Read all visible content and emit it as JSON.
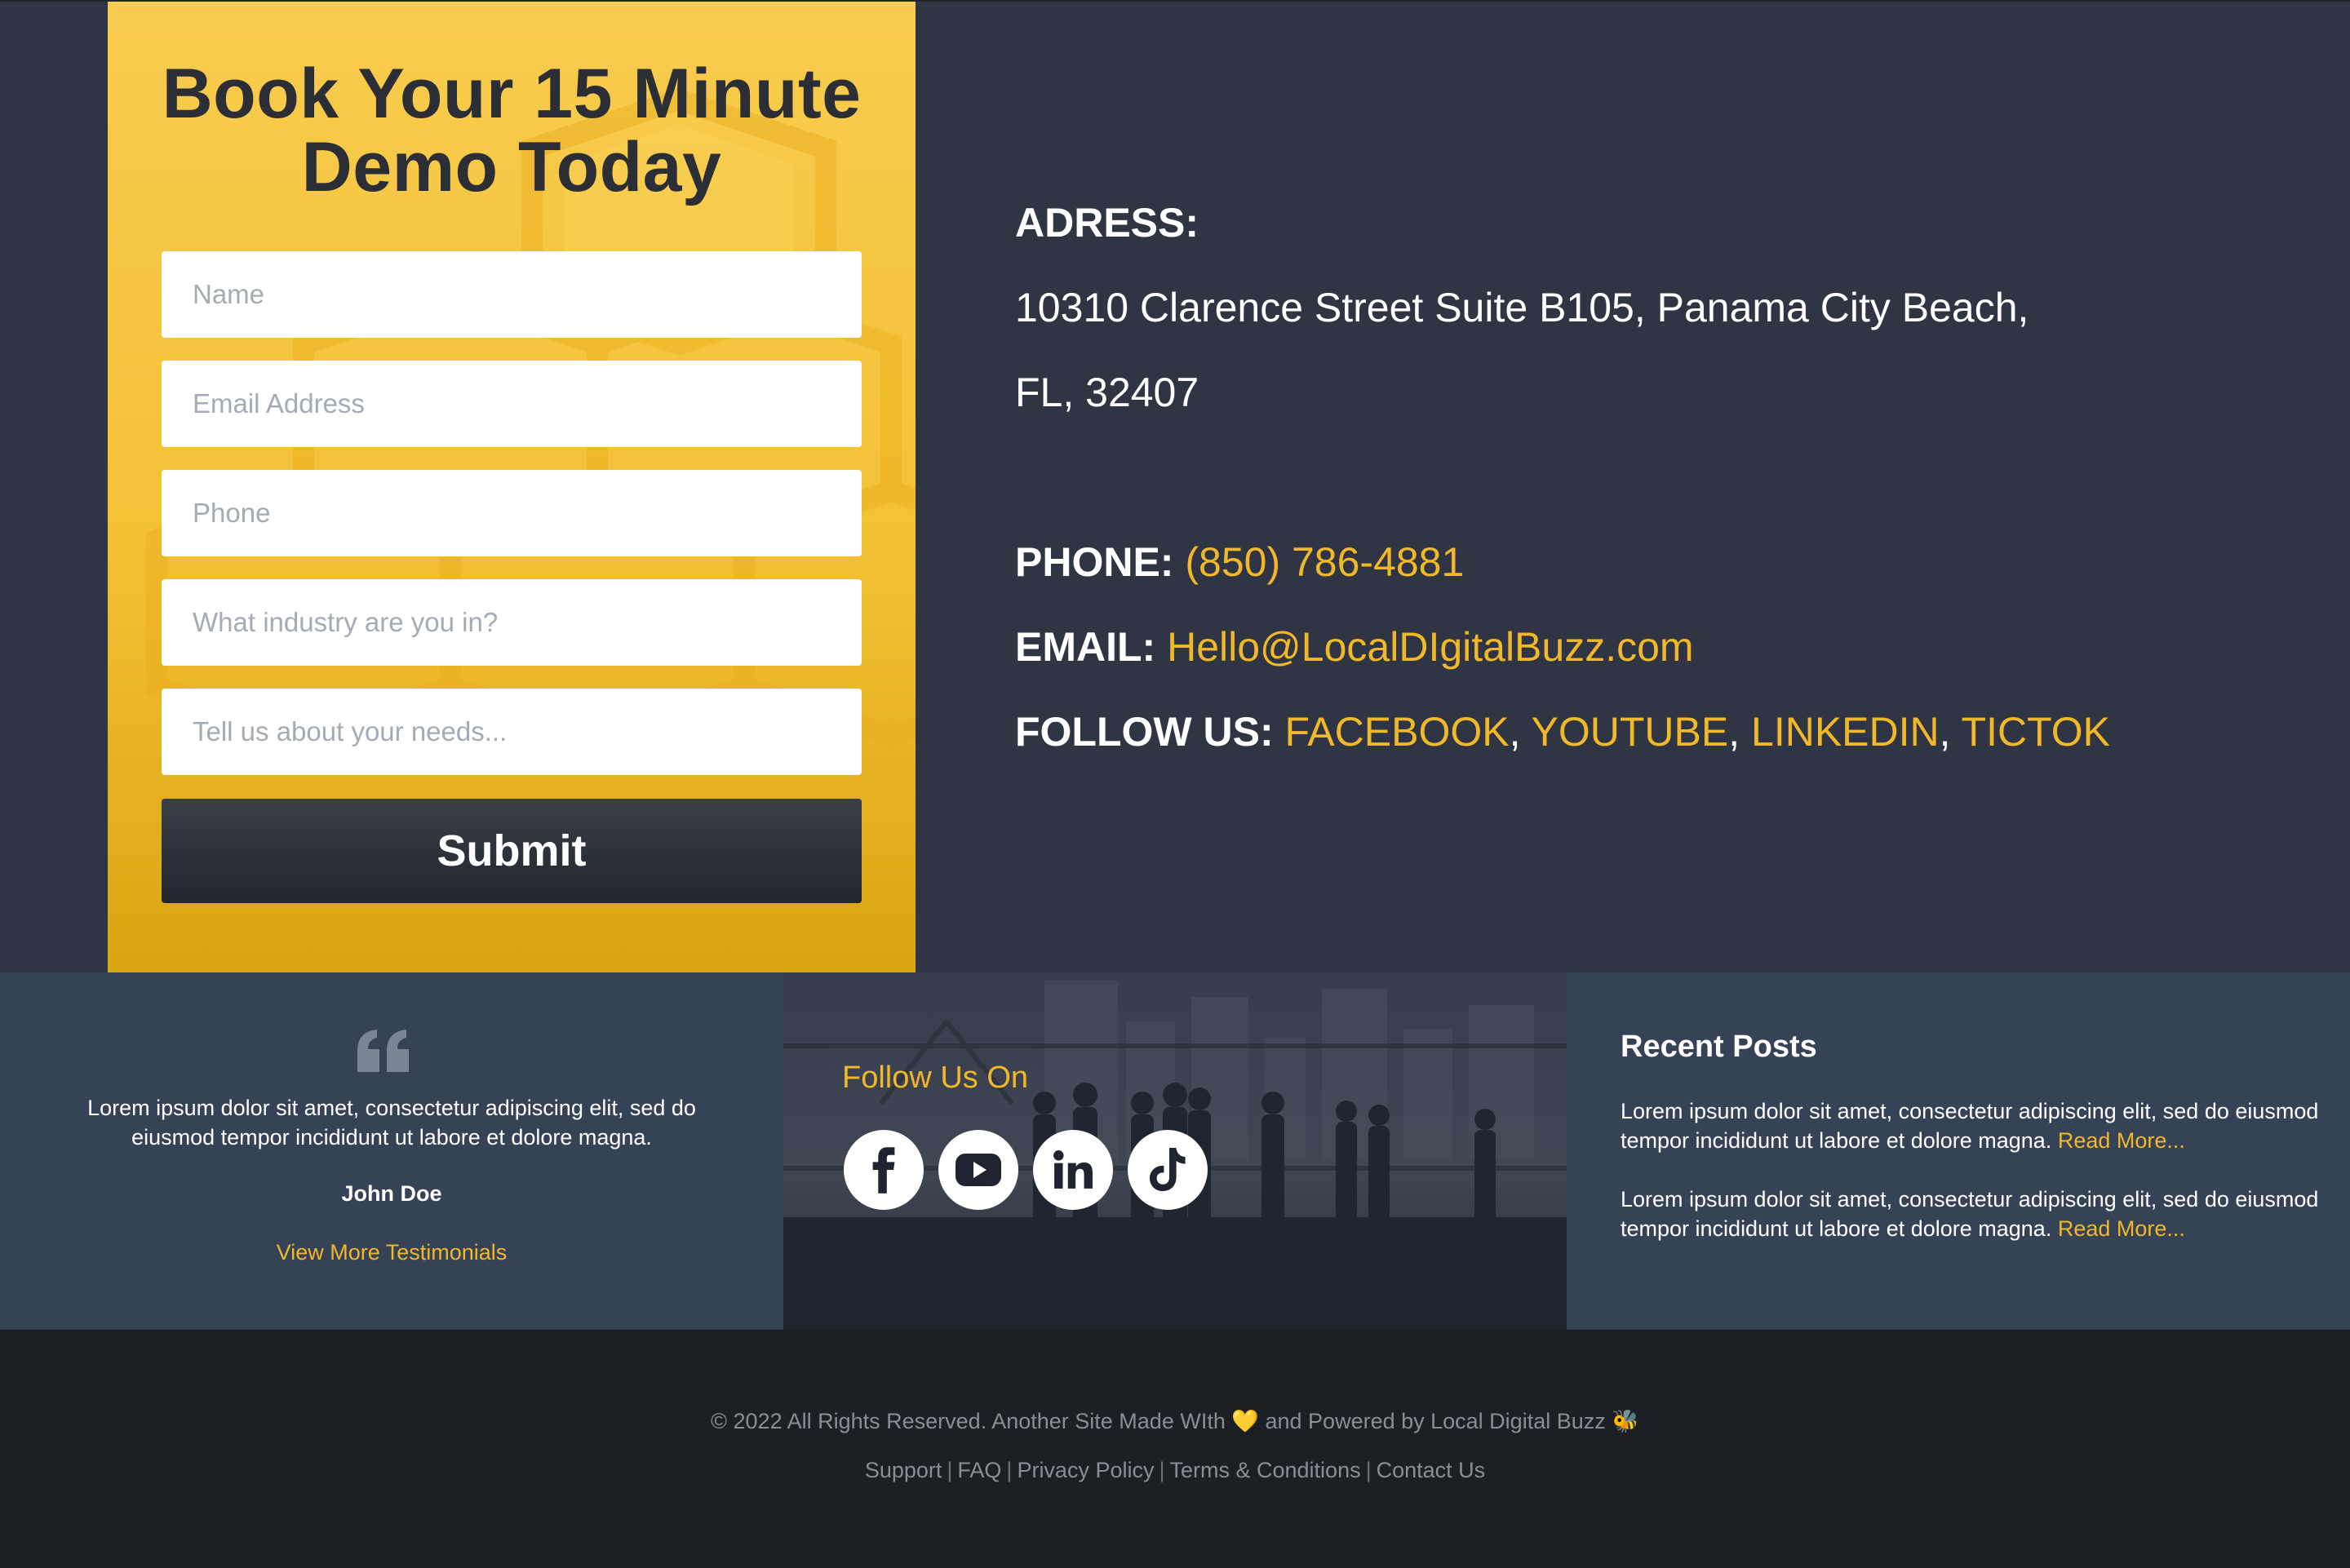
{
  "form": {
    "title_line1": "Book Your 15 Minute",
    "title_line2": "Demo Today",
    "fields": [
      {
        "placeholder": "Name"
      },
      {
        "placeholder": "Email Address"
      },
      {
        "placeholder": "Phone"
      },
      {
        "placeholder": "What industry are you in?"
      },
      {
        "placeholder": "Tell us about your needs..."
      }
    ],
    "submit_label": "Submit"
  },
  "contact": {
    "address_label": "ADRESS:",
    "address_line1": "10310 Clarence Street Suite B105, Panama City Beach,",
    "address_line2": "FL, 32407",
    "phone_label": "PHONE:",
    "phone": "(850) 786-4881",
    "email_label": "EMAIL:",
    "email": "Hello@LocalDIgitalBuzz.com",
    "follow_label": "FOLLOW US:",
    "social_links": [
      "FACEBOOK",
      "YOUTUBE",
      "LINKEDIN",
      "TICTOK"
    ],
    "separator": ","
  },
  "testimonial": {
    "quote_icon": "quote-icon",
    "text": "Lorem ipsum dolor sit amet, consectetur adipiscing elit, sed do eiusmod tempor incididunt ut labore et dolore magna.",
    "author": "John Doe",
    "more_link": "View More Testimonials"
  },
  "follow": {
    "title": "Follow Us On",
    "icons": [
      "facebook-icon",
      "youtube-icon",
      "linkedin-icon",
      "tiktok-icon"
    ]
  },
  "recent_posts": {
    "title": "Recent Posts",
    "items": [
      {
        "text": "Lorem ipsum dolor sit amet, consectetur adipiscing elit, sed do eiusmod tempor incididunt ut labore et dolore magna.",
        "link": "Read More..."
      },
      {
        "text": "Lorem ipsum dolor sit amet, consectetur adipiscing elit, sed do eiusmod tempor incididunt ut labore et dolore magna.",
        "link": "Read More..."
      }
    ]
  },
  "footer": {
    "copyright_before": "© 2022 All Rights Reserved. Another Site Made WIth",
    "heart": "💛",
    "copyright_after": "and Powered by Local Digital Buzz",
    "bee": "🐝",
    "links": [
      "Support",
      "FAQ",
      "Privacy Policy",
      "Terms & Conditions",
      "Contact Us"
    ],
    "separator": "|"
  },
  "colors": {
    "accent": "#f1b82a",
    "form_bg": "#f4c136",
    "dark_bg": "#2f3542",
    "band_bg": "#364256",
    "footer_bg": "#1c1f23"
  }
}
